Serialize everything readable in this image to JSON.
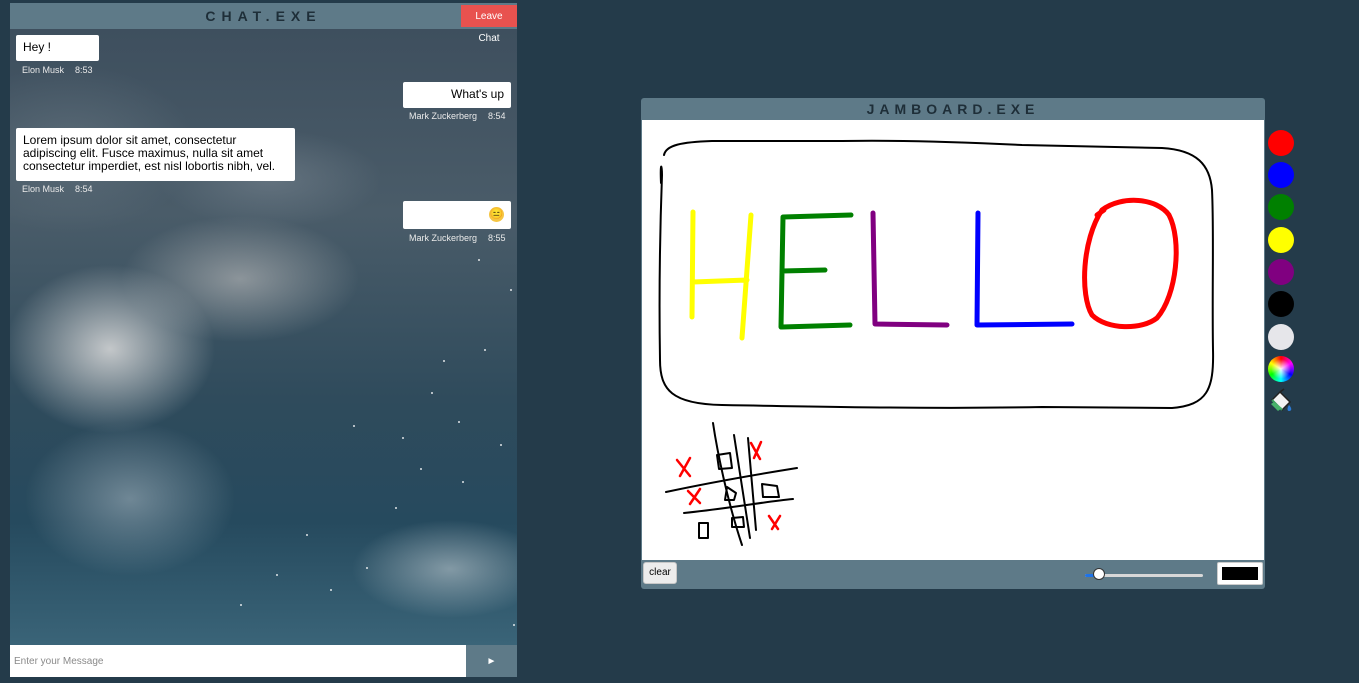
{
  "chat": {
    "title": "CHAT.EXE",
    "leave_label": "Leave Chat",
    "messages": [
      {
        "text": "Hey !",
        "sender": "Elon Musk",
        "time": "8:53",
        "side": "left"
      },
      {
        "text": "What's up",
        "sender": "Mark Zuckerberg",
        "time": "8:54",
        "side": "right"
      },
      {
        "text": "Lorem ipsum dolor sit amet, consectetur adipiscing elit. Fusce maximus, nulla sit amet consectetur imperdiet, est nisl lobortis nibh, vel.",
        "sender": "Elon Musk",
        "time": "8:54",
        "side": "left"
      },
      {
        "text": "😑",
        "sender": "Mark Zuckerberg",
        "time": "8:55",
        "side": "right"
      }
    ],
    "input_placeholder": "Enter your Message",
    "send_label": "►"
  },
  "jamboard": {
    "title": "JAMBOARD.EXE",
    "clear_label": "clear",
    "brush_size_fraction": 0.12,
    "current_color": "#000000",
    "palette": [
      {
        "name": "red",
        "color": "#ff0000"
      },
      {
        "name": "blue",
        "color": "#0000ff"
      },
      {
        "name": "green",
        "color": "#008000"
      },
      {
        "name": "yellow",
        "color": "#ffff00"
      },
      {
        "name": "purple",
        "color": "#800080"
      },
      {
        "name": "black",
        "color": "#000000"
      },
      {
        "name": "white",
        "color": "#e6e6ea"
      }
    ],
    "tools": [
      "color-wheel-icon",
      "paint-bucket-icon"
    ]
  }
}
